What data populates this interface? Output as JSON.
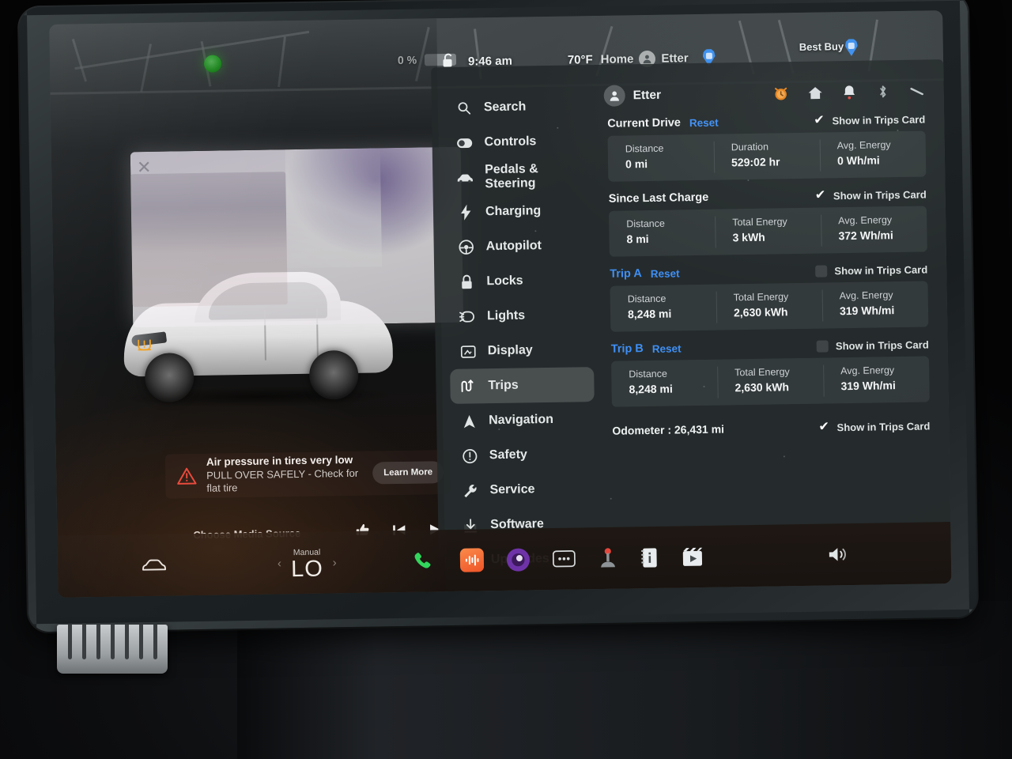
{
  "status_bar": {
    "battery_percent": "0 %",
    "time": "9:46 am",
    "temperature": "70°F",
    "nav_destination_prefix": "Home",
    "nav_destination": "Etter",
    "map_poi_label": "Best Buy",
    "indicator_dot": "green-indicator"
  },
  "panel": {
    "sidebar": {
      "items": [
        {
          "label": "Search",
          "icon": "search-icon"
        },
        {
          "label": "Controls",
          "icon": "toggle-icon"
        },
        {
          "label": "Pedals & Steering",
          "icon": "car-icon"
        },
        {
          "label": "Charging",
          "icon": "bolt-icon"
        },
        {
          "label": "Autopilot",
          "icon": "steering-wheel-icon"
        },
        {
          "label": "Locks",
          "icon": "lock-icon"
        },
        {
          "label": "Lights",
          "icon": "headlight-icon"
        },
        {
          "label": "Display",
          "icon": "display-icon"
        },
        {
          "label": "Trips",
          "icon": "trips-icon",
          "selected": true
        },
        {
          "label": "Navigation",
          "icon": "navigation-arrow-icon"
        },
        {
          "label": "Safety",
          "icon": "warning-circle-icon"
        },
        {
          "label": "Service",
          "icon": "wrench-icon"
        },
        {
          "label": "Software",
          "icon": "download-icon"
        },
        {
          "label": "Upgrades",
          "icon": "upgrade-lock-icon"
        }
      ]
    },
    "header": {
      "profile_name": "Etter",
      "icons": [
        "alarm-clock-icon",
        "home-icon",
        "bell-icon",
        "bluetooth-icon",
        "wifi-icon"
      ]
    },
    "columns": {
      "distance": "Distance",
      "duration": "Duration",
      "total_energy": "Total Energy",
      "avg_energy": "Avg. Energy"
    },
    "show_in_trips_card_label": "Show in Trips Card",
    "reset_label": "Reset",
    "sections": [
      {
        "title": "Current Drive",
        "title_color": "#f2f4f5",
        "has_reset": true,
        "show_in_trips_card": true,
        "stats": [
          {
            "label": "Distance",
            "value": "0 mi"
          },
          {
            "label": "Duration",
            "value": "529:02 hr"
          },
          {
            "label": "Avg. Energy",
            "value": "0 Wh/mi"
          }
        ]
      },
      {
        "title": "Since Last Charge",
        "title_color": "#f2f4f5",
        "has_reset": false,
        "show_in_trips_card": true,
        "stats": [
          {
            "label": "Distance",
            "value": "8 mi"
          },
          {
            "label": "Total Energy",
            "value": "3 kWh"
          },
          {
            "label": "Avg. Energy",
            "value": "372 Wh/mi"
          }
        ]
      },
      {
        "title": "Trip A",
        "title_color": "#3f8ff5",
        "has_reset": true,
        "show_in_trips_card": false,
        "stats": [
          {
            "label": "Distance",
            "value": "8,248 mi"
          },
          {
            "label": "Total Energy",
            "value": "2,630 kWh"
          },
          {
            "label": "Avg. Energy",
            "value": "319 Wh/mi"
          }
        ]
      },
      {
        "title": "Trip B",
        "title_color": "#3f8ff5",
        "has_reset": true,
        "show_in_trips_card": false,
        "stats": [
          {
            "label": "Distance",
            "value": "8,248 mi"
          },
          {
            "label": "Total Energy",
            "value": "2,630 kWh"
          },
          {
            "label": "Avg. Energy",
            "value": "319 Wh/mi"
          }
        ]
      }
    ],
    "odometer": {
      "text": "Odometer :  26,431 mi",
      "show_in_trips_card": true
    }
  },
  "alert": {
    "title": "Air pressure in tires very low",
    "subtitle": "PULL OVER SAFELY - Check for flat tire",
    "button": "Learn More",
    "icon": "warning-triangle-icon",
    "accent_color": "#e8453c",
    "tpms_icon": "tire-pressure-warning-icon",
    "tpms_color": "#f0a020"
  },
  "media": {
    "source_label": "Choose Media Source",
    "controls": [
      "thumbs-up-icon",
      "previous-track-icon",
      "play-icon",
      "next-track-icon"
    ]
  },
  "taskbar": {
    "car_icon": "car-icon",
    "climate": {
      "mode": "Manual",
      "temperature": "LO",
      "left_chevron": "‹",
      "right_chevron": "›"
    },
    "apps": [
      {
        "name": "phone-icon",
        "color": "#2fd75c"
      },
      {
        "name": "audio-waveform-icon",
        "color": "#f2622c"
      },
      {
        "name": "spotify-circle-icon",
        "color": "#7b3fb5"
      },
      {
        "name": "more-dots-icon",
        "color": "#d6dadb"
      },
      {
        "name": "arcade-joystick-icon",
        "color": "#e5463c"
      },
      {
        "name": "owners-manual-icon",
        "color": "#e8ecee"
      },
      {
        "name": "theater-video-icon",
        "color": "#e8ecee"
      },
      {
        "name": "volume-speaker-icon",
        "color": "#dfe4e5"
      }
    ]
  }
}
